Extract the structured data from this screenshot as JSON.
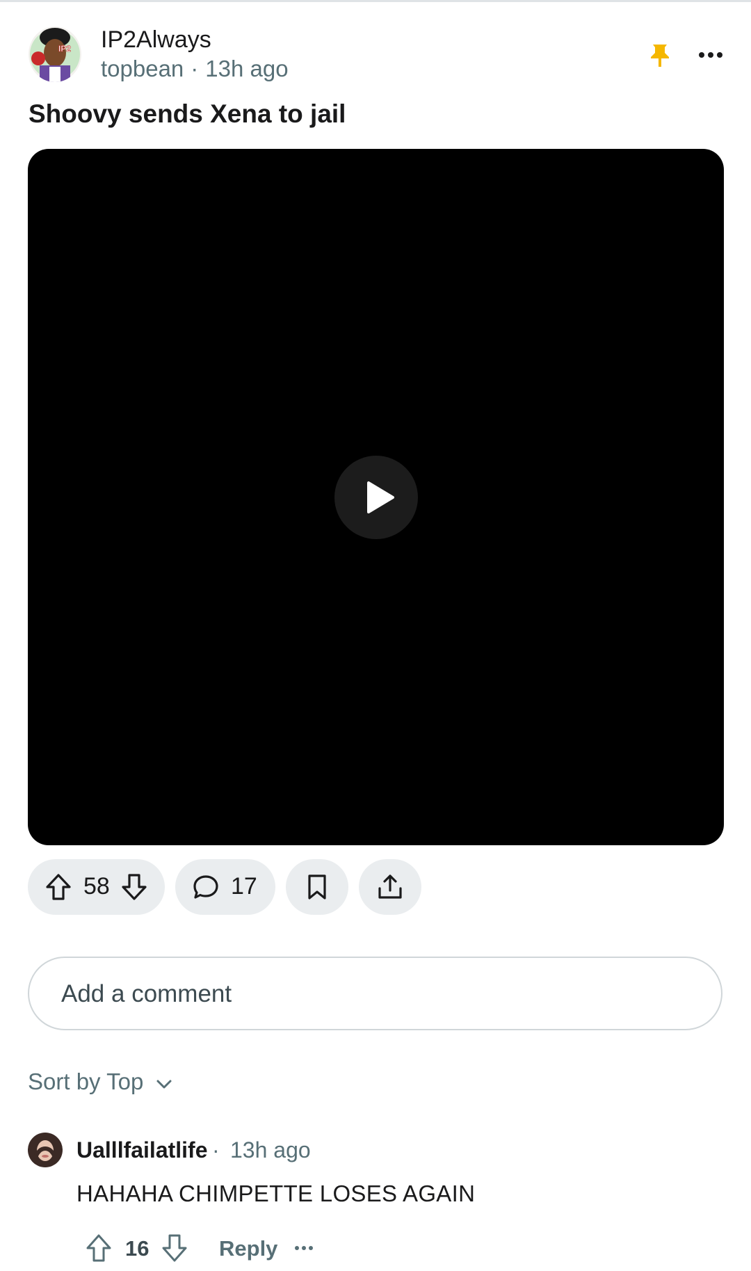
{
  "post": {
    "community": "IP2Always",
    "author": "topbean",
    "separator": "·",
    "time": "13h ago",
    "title": "Shoovy sends Xena to jail",
    "avatar_badge": "IP2",
    "icons": {
      "pin": "pin-icon",
      "more": "more-icon",
      "play": "play-icon"
    },
    "accent_color": "#f5b700"
  },
  "actions": {
    "votes": "58",
    "comments": "17",
    "icons": [
      "upvote-icon",
      "downvote-icon",
      "comment-icon",
      "save-icon",
      "share-icon"
    ]
  },
  "comment_box": {
    "placeholder": "Add a comment"
  },
  "sort": {
    "label": "Sort by Top"
  },
  "comments": [
    {
      "author": "Ualllfailatlife",
      "separator": "·",
      "time": "13h ago",
      "body": "HAHAHA CHIMPETTE LOSES AGAIN",
      "votes": "16",
      "reply_label": "Reply"
    }
  ]
}
